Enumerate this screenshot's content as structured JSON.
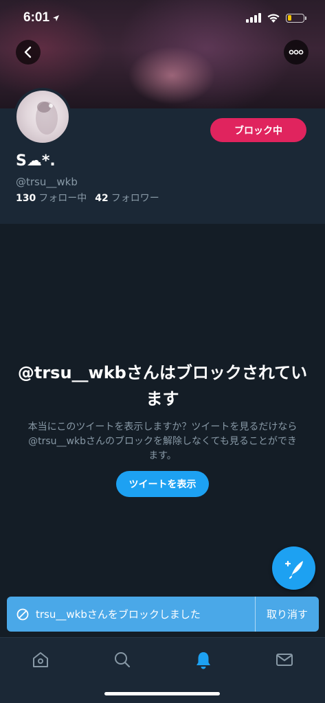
{
  "status_bar": {
    "time": "6:01",
    "battery_level": 0.25,
    "battery_color": "#f5c400"
  },
  "header": {
    "back_icon": "chevron-left-icon",
    "more_icon": "more-dots-icon"
  },
  "profile": {
    "display_name": "S☁*.",
    "handle": "@trsu__wkb",
    "following_count": "130",
    "following_label": "フォロー中",
    "followers_count": "42",
    "followers_label": "フォロワー",
    "block_button_label": "ブロック中",
    "block_button_color": "#e0245e"
  },
  "blocked_notice": {
    "title": "@trsu__wkbさんはブロックされています",
    "description": "本当にこのツイートを表示しますか？ツイートを見るだけなら@trsu__wkbさんのブロックを解除しなくても見ることができます。",
    "show_button_label": "ツイートを表示"
  },
  "compose_fab": {
    "icon": "compose-feather-icon"
  },
  "toast": {
    "icon": "block-icon",
    "message": "trsu__wkbさんをブロックしました",
    "undo_label": "取り消す",
    "color": "#4aa8e8"
  },
  "tab_bar": {
    "tabs": [
      {
        "icon": "home-icon",
        "active": false
      },
      {
        "icon": "search-icon",
        "active": false
      },
      {
        "icon": "notifications-bell-icon",
        "active": true
      },
      {
        "icon": "messages-envelope-icon",
        "active": false
      }
    ],
    "active_color": "#1da1f2",
    "inactive_color": "#8899a6"
  }
}
